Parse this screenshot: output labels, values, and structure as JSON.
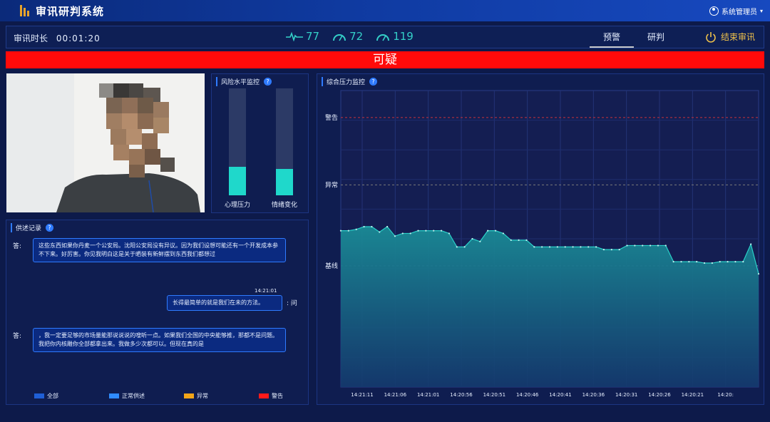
{
  "app": {
    "title": "审讯研判系统",
    "user": "系统管理员",
    "logo_color": "#e8a32a"
  },
  "status": {
    "duration_label": "审讯时长",
    "duration_value": "00:01:20",
    "metrics": [
      {
        "icon": "heartbeat-icon",
        "value": "77"
      },
      {
        "icon": "gauge-icon",
        "value": "72"
      },
      {
        "icon": "gauge-icon",
        "value": "119"
      }
    ],
    "tabs": [
      "预警",
      "研判"
    ],
    "active_tab": "预警",
    "end_button": "结束审讯"
  },
  "alert": {
    "text": "可疑",
    "color": "#ff0a0a"
  },
  "risk": {
    "title": "风险水平监控",
    "bars": [
      {
        "label": "心理压力",
        "level": 0.27
      },
      {
        "label": "情绪变化",
        "level": 0.25
      }
    ]
  },
  "transcript": {
    "title": "供述记录",
    "messages": [
      {
        "speaker": "答:",
        "side": "left",
        "text": "这些东西如果你丹麦一个公安局。沈阳公安局没有异议。因为我们设想可能还有一个开发成本参不下来。好厉害。你见我明白这是关于晒装有新鲜摆到东西我们都想过"
      },
      {
        "speaker": ": 问",
        "side": "right",
        "time": "14:21:01",
        "text": "长得最简单的就是我们在未的方法。"
      },
      {
        "speaker": "答:",
        "side": "left",
        "text": "，我一定要足够的市场量能那说说说的嗖听一点。如果我们全国的中央能够推，那都不是问题。我把你内核雕你全部都拿出来。我做多少次都可以。但现在真的是"
      }
    ],
    "legend": [
      {
        "label": "全部",
        "color": "#1f5fd6"
      },
      {
        "label": "正常供述",
        "color": "#2f8bff"
      },
      {
        "label": "异常",
        "color": "#f2a518"
      },
      {
        "label": "警告",
        "color": "#ff1a1a"
      }
    ]
  },
  "chart_data": {
    "type": "area",
    "title": "综合压力监控",
    "y_levels": [
      {
        "label": "警告",
        "value": 100
      },
      {
        "label": "异常",
        "value": 75
      },
      {
        "label": "基线",
        "value": 45
      }
    ],
    "ylim": [
      0,
      110
    ],
    "x_ticks": [
      "14:21:11",
      "14:21:06",
      "14:21:01",
      "14:20:56",
      "14:20:51",
      "14:20:46",
      "14:20:41",
      "14:20:36",
      "14:20:31",
      "14:20:26",
      "14:20:21",
      "14:20:"
    ],
    "series": [
      {
        "values": [
          58,
          58,
          58.5,
          59.5,
          59.5,
          57.5,
          59.5,
          56,
          57,
          57,
          58,
          58,
          58,
          58,
          57,
          52,
          52,
          55,
          54,
          58,
          58,
          57,
          54.5,
          54.5,
          54.5,
          52,
          52,
          52,
          52,
          52,
          52,
          52,
          52,
          52,
          51,
          51,
          51,
          52.5,
          52.5,
          52.5,
          52.5,
          52.5,
          52.5,
          46.5,
          46.5,
          46.5,
          46.5,
          46,
          46,
          46.5,
          46.5,
          46.5,
          46.5,
          53,
          42
        ]
      }
    ],
    "fill_color": "#1a8b96",
    "line_color": "#2ad0c8",
    "grid": true
  }
}
